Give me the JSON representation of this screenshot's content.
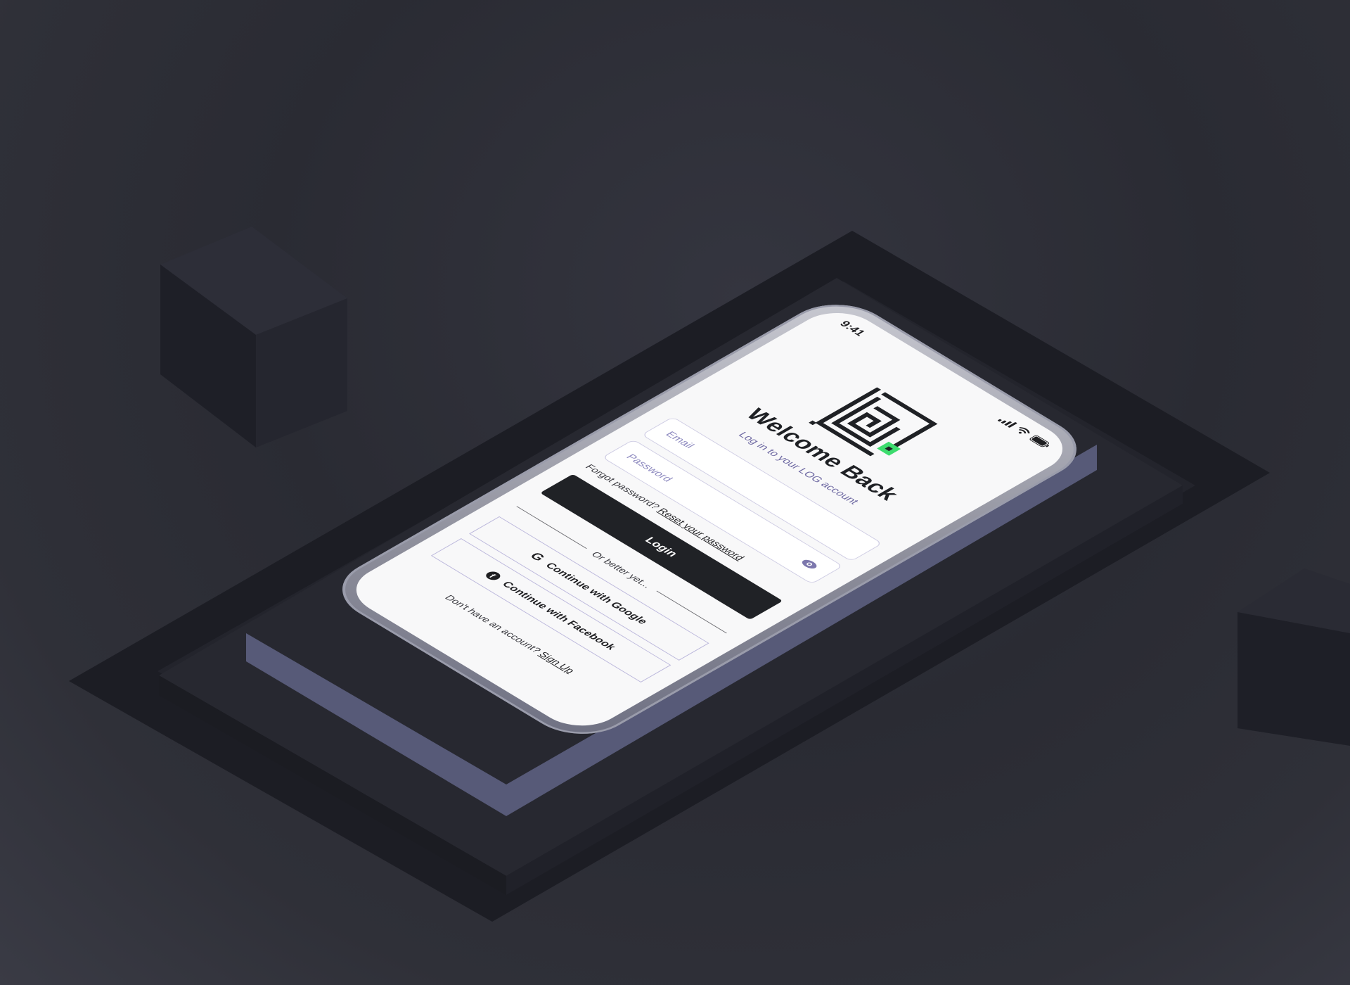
{
  "status_bar": {
    "time": "9:41",
    "icons": [
      "signal-icon",
      "wifi-icon",
      "battery-icon"
    ]
  },
  "logo": {
    "icon": "maze-logo-icon",
    "accent_color": "#3ddc6e",
    "color": "#1f2125"
  },
  "header": {
    "title": "Welcome Back",
    "subtitle": "Log in to your LOG account"
  },
  "form": {
    "email": {
      "placeholder": "Email",
      "value": ""
    },
    "password": {
      "placeholder": "Password",
      "value": ""
    },
    "password_toggle_icon": "eye-icon",
    "forgot_prefix": "Forgot password?",
    "forgot_link": "Reset your password",
    "login_label": "Login"
  },
  "divider": {
    "text": "Or better yet..."
  },
  "social": {
    "google_label": "Continue with Google",
    "google_icon": "G",
    "facebook_label": "Continue with Facebook",
    "facebook_icon": "f"
  },
  "footer": {
    "prefix": "Don't have an account?",
    "signup_link": "Sign Up"
  },
  "colors": {
    "background": "#2c2d35",
    "screen": "#f8f8f9",
    "primary_button": "#202226",
    "placeholder": "#8f8bc0",
    "subtitle": "#6f6aa3"
  }
}
